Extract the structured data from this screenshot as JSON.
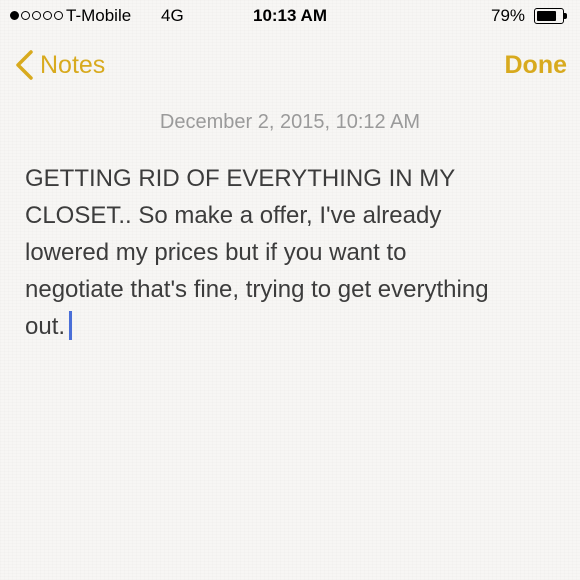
{
  "status_bar": {
    "signal_bars_filled": 1,
    "signal_bars_total": 5,
    "carrier": "T-Mobile",
    "network": "4G",
    "time": "10:13 AM",
    "battery_percent_label": "79%",
    "battery_level": 0.79
  },
  "nav": {
    "back_label": "Notes",
    "done_label": "Done",
    "accent_color": "#d8aa1e"
  },
  "note": {
    "date": "December 2, 2015, 10:12 AM",
    "lines": [
      "GETTING RID OF EVERYTHING IN MY",
      "CLOSET.. So make a offer, I've already",
      "lowered my prices but if you want to",
      "negotiate that's fine, trying to get everything",
      "out."
    ]
  }
}
